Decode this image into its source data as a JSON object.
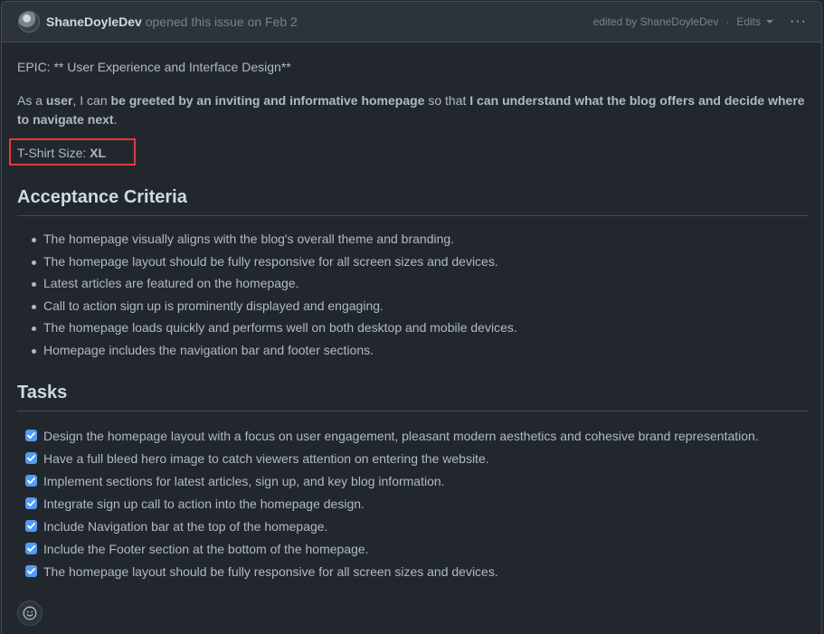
{
  "header": {
    "author": "ShaneDoyleDev",
    "action_text": "opened this issue on Feb 2",
    "edited_by": "edited by ShaneDoyleDev",
    "separator": "·",
    "edits_label": "Edits",
    "more_label": "···"
  },
  "body": {
    "epic_line": "EPIC: ** User Experience and Interface Design**",
    "story": {
      "p1": "As a ",
      "b1": "user",
      "p2": ", I can ",
      "b2": "be greeted by an inviting and informative homepage",
      "p3": " so that ",
      "b3": "I can understand what the blog offers and decide where to navigate next",
      "p4": "."
    },
    "tshirt_label": "T-Shirt Size: ",
    "tshirt_value": "XL",
    "acceptance_heading": "Acceptance Criteria",
    "acceptance_items": [
      "The homepage visually aligns with the blog's overall theme and branding.",
      "The homepage layout should be fully responsive for all screen sizes and devices.",
      "Latest articles are featured on the homepage.",
      "Call to action sign up is prominently displayed and engaging.",
      "The homepage loads quickly and performs well on both desktop and mobile devices.",
      "Homepage includes the navigation bar and footer sections."
    ],
    "tasks_heading": "Tasks",
    "tasks": [
      {
        "label": "Design the homepage layout with a focus on user engagement, pleasant modern aesthetics and cohesive brand representation.",
        "checked": true
      },
      {
        "label": "Have a full bleed hero image to catch viewers attention on entering the website.",
        "checked": true
      },
      {
        "label": "Implement sections for latest articles, sign up, and key blog information.",
        "checked": true
      },
      {
        "label": "Integrate sign up call to action into the homepage design.",
        "checked": true
      },
      {
        "label": "Include Navigation bar at the top of the homepage.",
        "checked": true
      },
      {
        "label": "Include the Footer section at the bottom of the homepage.",
        "checked": true
      },
      {
        "label": "The homepage layout should be fully responsive for all screen sizes and devices.",
        "checked": true
      }
    ]
  },
  "icons": {
    "avatar": "user-avatar",
    "reaction": "smiley-icon",
    "checkbox": "check-icon",
    "caret": "caret-down-icon"
  },
  "colors": {
    "background": "#22272e",
    "header_bg": "#2d333b",
    "border": "#444c56",
    "text": "#adbac7",
    "muted": "#768390",
    "checkbox": "#539bf5",
    "highlight_box": "#e5383b"
  }
}
